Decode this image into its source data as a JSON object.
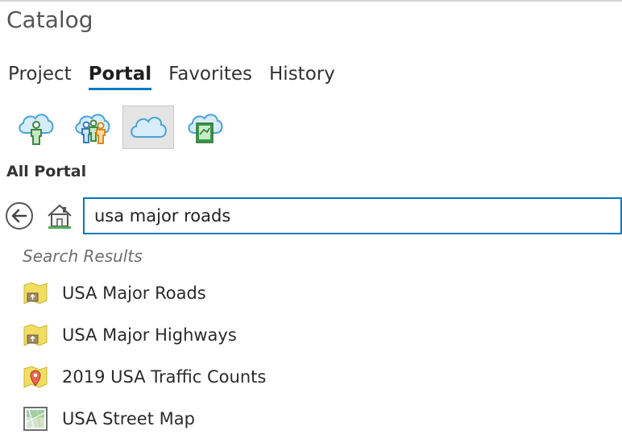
{
  "pane": {
    "title": "Catalog"
  },
  "tabs": [
    {
      "label": "Project",
      "active": false
    },
    {
      "label": "Portal",
      "active": true
    },
    {
      "label": "Favorites",
      "active": false
    },
    {
      "label": "History",
      "active": false
    }
  ],
  "portal_icons": [
    {
      "name": "my-content-icon",
      "selected": false
    },
    {
      "name": "my-groups-icon",
      "selected": false
    },
    {
      "name": "all-portal-icon",
      "selected": true
    },
    {
      "name": "living-atlas-icon",
      "selected": false
    }
  ],
  "section": {
    "label": "All Portal"
  },
  "search": {
    "value": "usa major roads"
  },
  "results": {
    "header": "Search Results",
    "items": [
      {
        "label": "USA Major Roads",
        "icon": "layer-package-icon"
      },
      {
        "label": "USA Major Highways",
        "icon": "layer-package-icon"
      },
      {
        "label": "2019 USA Traffic Counts",
        "icon": "feature-layer-icon"
      },
      {
        "label": "USA Street Map",
        "icon": "map-image-icon"
      }
    ]
  },
  "colors": {
    "accent": "#0079c1",
    "selected_bg": "#e4e4e4"
  }
}
